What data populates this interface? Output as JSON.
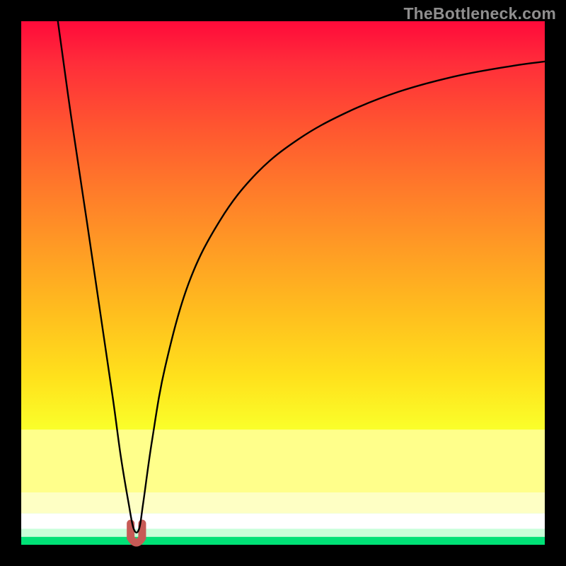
{
  "watermark": "TheBottleneck.com",
  "chart_data": {
    "type": "line",
    "title": "",
    "xlabel": "",
    "ylabel": "",
    "xlim": [
      0,
      100
    ],
    "ylim": [
      0,
      100
    ],
    "series": [
      {
        "name": "bottleneck-curve",
        "x": [
          7.0,
          9.5,
          12.5,
          15.0,
          17.5,
          19.0,
          20.5,
          21.5,
          22.5,
          23.3,
          25.0,
          27.5,
          32.0,
          38.0,
          45.0,
          53.0,
          62.0,
          72.0,
          83.0,
          94.0,
          100.0
        ],
        "values": [
          100.0,
          82.0,
          62.0,
          45.0,
          28.0,
          17.0,
          8.0,
          3.0,
          3.0,
          8.0,
          20.0,
          34.0,
          50.0,
          62.0,
          71.0,
          77.5,
          82.5,
          86.5,
          89.5,
          91.5,
          92.3
        ]
      }
    ],
    "marker": {
      "name": "optimal-region",
      "x_center": 22.0,
      "width_pct": 2.2,
      "color": "#c75a56"
    },
    "bands": [
      {
        "name": "yellow-band",
        "y_top": 22.0,
        "y_bottom": 10.0,
        "color": "#ffff8b"
      },
      {
        "name": "pale-yellow-band",
        "y_top": 10.0,
        "y_bottom": 6.0,
        "color": "#feffc4"
      },
      {
        "name": "white-band",
        "y_top": 6.0,
        "y_bottom": 3.0,
        "color": "#ffffff"
      },
      {
        "name": "mint-band",
        "y_top": 3.0,
        "y_bottom": 1.5,
        "color": "#c8ffd8"
      },
      {
        "name": "green-band",
        "y_top": 1.5,
        "y_bottom": 0.0,
        "color": "#00e176"
      }
    ]
  }
}
